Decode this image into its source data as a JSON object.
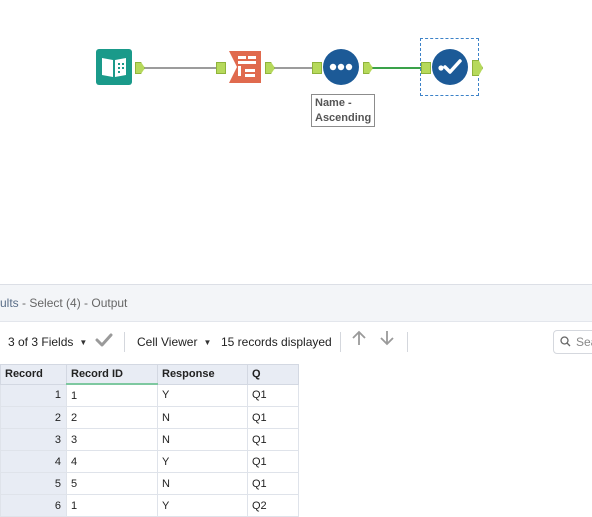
{
  "workflow": {
    "annotation_line1": "Name -",
    "annotation_line2": "Ascending"
  },
  "results": {
    "title_prefix": "ults",
    "title_suffix": " - Select (4) - Output",
    "fields_label": "3 of 3 Fields",
    "viewer_label": "Cell Viewer",
    "records_label": "15 records displayed",
    "search_placeholder": "Sea"
  },
  "table": {
    "headers": [
      "Record",
      "Record ID",
      "Response",
      "Q"
    ],
    "rows": [
      {
        "record": "1",
        "record_id": "1",
        "response": "Y",
        "q": "Q1"
      },
      {
        "record": "2",
        "record_id": "2",
        "response": "N",
        "q": "Q1"
      },
      {
        "record": "3",
        "record_id": "3",
        "response": "N",
        "q": "Q1"
      },
      {
        "record": "4",
        "record_id": "4",
        "response": "Y",
        "q": "Q1"
      },
      {
        "record": "5",
        "record_id": "5",
        "response": "N",
        "q": "Q1"
      },
      {
        "record": "6",
        "record_id": "1",
        "response": "Y",
        "q": "Q2"
      }
    ]
  },
  "colors": {
    "input_tool": "#1a9a8a",
    "crosstab_tool": "#e06a4e",
    "sort_tool": "#1c5a97",
    "select_tool": "#1c5a97"
  }
}
